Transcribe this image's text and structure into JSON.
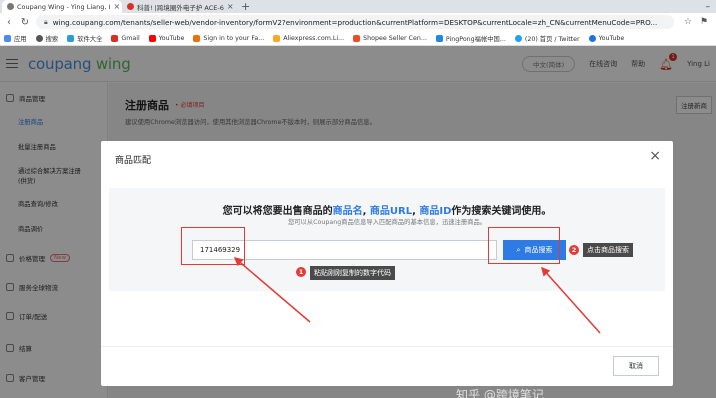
{
  "browser": {
    "tabs": [
      {
        "title": "Coupang Wing - Ying Liang, I",
        "active": true
      },
      {
        "title": "科普! |跨境圈外电子护 ACE-6",
        "active": false
      }
    ],
    "new_tab": "+",
    "url": "wing.coupang.com/tenants/seller-web/vendor-inventory/formV2?environment=production&currentPlatform=DESKTOP&currentLocale=zh_CN&currentMenuCode=PRO...",
    "bookmarks": [
      {
        "label": "应用",
        "color": "#4a8af4"
      },
      {
        "label": "搜索",
        "color": "#555555"
      },
      {
        "label": "软件大全",
        "color": "#2e9bd6"
      },
      {
        "label": "Gmail",
        "color": "#d93025"
      },
      {
        "label": "YouTube",
        "color": "#ff0000"
      },
      {
        "label": "Sign in to your Fa...",
        "color": "#e8710a"
      },
      {
        "label": "Aliexpress.com.Li...",
        "color": "#f9a825"
      },
      {
        "label": "Shopee Seller Cen...",
        "color": "#ee4d2d"
      },
      {
        "label": "PingPong福帐中国...",
        "color": "#1e88e5"
      },
      {
        "label": "(20) 首页 / Twitter",
        "color": "#1da1f2"
      },
      {
        "label": "YouTube",
        "color": "#1a73e8"
      }
    ]
  },
  "header": {
    "logo_part1": "coupang",
    "logo_part2": "wing",
    "language": "中文(简体)",
    "contact": "在线咨询",
    "help": "帮助",
    "notification_count": "1",
    "user": "Ying Li"
  },
  "sidebar": {
    "section1": "商品管理",
    "sub_items": [
      "注册商品",
      "批量注册商品",
      "通过综合解决方案注册",
      "(供货)",
      "商品查询/修改",
      "商品调价"
    ],
    "section2": "价格管理",
    "section2_badge": "New",
    "section3": "服务全球物流",
    "section4": "订单/配送",
    "section5": "结算",
    "section6": "客户管理"
  },
  "main": {
    "title": "注册商品",
    "required_tag": "• 必填项目",
    "note": "建议使用Chrome浏览器访问，使用其他浏览器Chrome不版本时，则展示部分商品信息。",
    "right_button": "注册新商"
  },
  "modal": {
    "title": "商品匹配",
    "headline_pre": "您可以将您要出售商品的",
    "hl_name": "商品名",
    "sep1": ", ",
    "hl_url": "商品URL",
    "sep2": ", ",
    "hl_id": "商品ID",
    "headline_post": "作为搜索关键词使用。",
    "subline": "您可以从Coupang商品信息导入匹配商品的基本信息，迅速注册商品。",
    "input_value": "171469329",
    "search_button": "商品搜索",
    "cancel_button": "取消"
  },
  "annotations": {
    "step1_num": "1",
    "step1_label": "粘贴刚刚复制的数字代码",
    "step2_num": "2",
    "step2_label": "点击商品搜索"
  },
  "watermark": "知乎 @跨境笔记"
}
